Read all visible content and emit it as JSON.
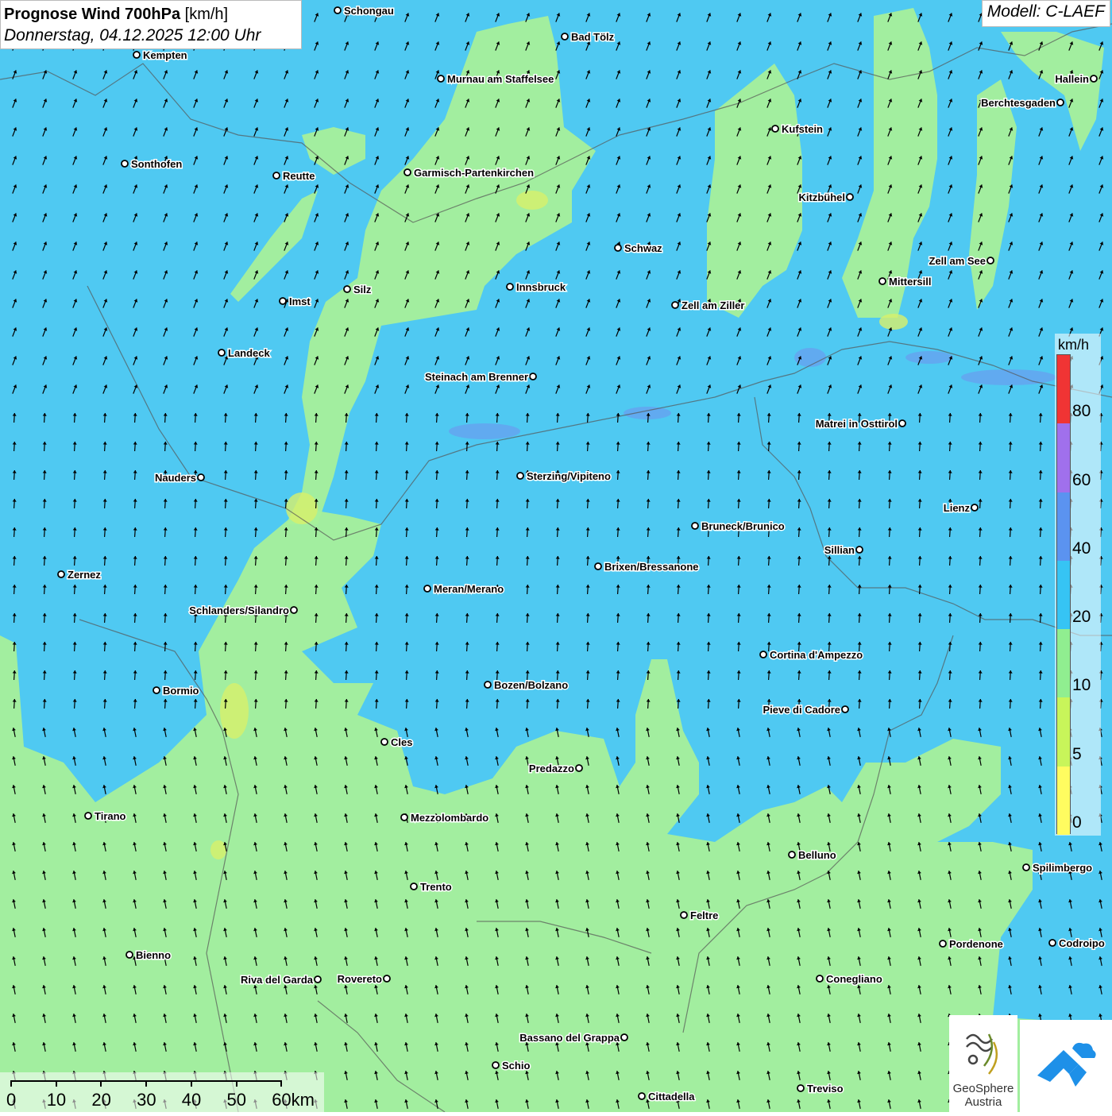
{
  "header": {
    "title_bold": "Prognose Wind 700hPa",
    "title_unit": "[km/h]",
    "datetime": "Donnerstag, 04.12.2025 12:00 Uhr",
    "model": "Modell: C-LAEF"
  },
  "legend": {
    "unit": "km/h",
    "classes": [
      {
        "label": "0",
        "color": "#fffc60"
      },
      {
        "label": "5",
        "color": "#c8f55a"
      },
      {
        "label": "10",
        "color": "#90ee90"
      },
      {
        "label": "20",
        "color": "#36c4f4"
      },
      {
        "label": "40",
        "color": "#5b93f0"
      },
      {
        "label": "60",
        "color": "#a070ec"
      },
      {
        "label": "80",
        "color": "#f03434"
      }
    ]
  },
  "scale_bar": {
    "labels": [
      "0",
      "10",
      "20",
      "30",
      "40",
      "50",
      "60km"
    ]
  },
  "logo": {
    "name_line1": "GeoSphere",
    "name_line2": "Austria"
  },
  "cities": [
    {
      "name": "Schongau"
    },
    {
      "name": "Bad Tölz"
    },
    {
      "name": "Kempten"
    },
    {
      "name": "Murnau am Staffelsee"
    },
    {
      "name": "Hallein"
    },
    {
      "name": "Berchtesgaden"
    },
    {
      "name": "Kufstein"
    },
    {
      "name": "Sonthofen"
    },
    {
      "name": "Reutte"
    },
    {
      "name": "Garmisch-Partenkirchen"
    },
    {
      "name": "Kitzbühel"
    },
    {
      "name": "Schwaz"
    },
    {
      "name": "Zell am See"
    },
    {
      "name": "Innsbruck"
    },
    {
      "name": "Mittersill"
    },
    {
      "name": "Silz"
    },
    {
      "name": "Imst"
    },
    {
      "name": "Zell am Ziller"
    },
    {
      "name": "Landeck"
    },
    {
      "name": "Steinach am Brenner"
    },
    {
      "name": "Matrei in Osttirol"
    },
    {
      "name": "Nauders"
    },
    {
      "name": "Sterzing/Vipiteno"
    },
    {
      "name": "Lienz"
    },
    {
      "name": "Bruneck/Brunico"
    },
    {
      "name": "Sillian"
    },
    {
      "name": "Brixen/Bressanone"
    },
    {
      "name": "Zernez"
    },
    {
      "name": "Meran/Merano"
    },
    {
      "name": "Schlanders/Silandro"
    },
    {
      "name": "Cortina d'Ampezzo"
    },
    {
      "name": "Bozen/Bolzano"
    },
    {
      "name": "Bormio"
    },
    {
      "name": "Pieve di Cadore"
    },
    {
      "name": "Cles"
    },
    {
      "name": "Predazzo"
    },
    {
      "name": "Tirano"
    },
    {
      "name": "Mezzolombardo"
    },
    {
      "name": "Belluno"
    },
    {
      "name": "Spilimbergo"
    },
    {
      "name": "Trento"
    },
    {
      "name": "Feltre"
    },
    {
      "name": "Pordenone"
    },
    {
      "name": "Codroipo"
    },
    {
      "name": "Bienno"
    },
    {
      "name": "Riva del Garda"
    },
    {
      "name": "Rovereto"
    },
    {
      "name": "Conegliano"
    },
    {
      "name": "Bassano del Grappa"
    },
    {
      "name": "Schio"
    },
    {
      "name": "Treviso"
    },
    {
      "name": "Cittadella"
    }
  ]
}
